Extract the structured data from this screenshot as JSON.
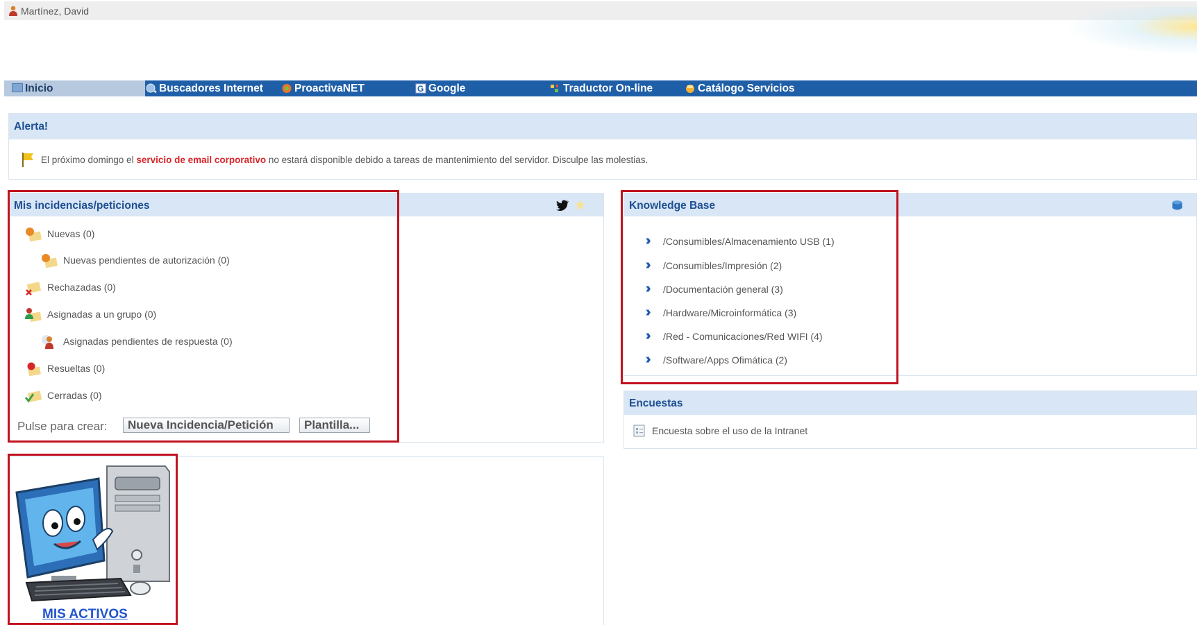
{
  "user": {
    "name": "Martínez, David",
    "icon": "user-icon"
  },
  "nav": {
    "items": [
      {
        "label": "Inicio",
        "icon": "home-icon",
        "active": true
      },
      {
        "label": "Buscadores Internet",
        "icon": "search-globe-icon"
      },
      {
        "label": "ProactivaNET",
        "icon": "proactivanet-icon"
      },
      {
        "label": "Google",
        "icon": "google-icon"
      },
      {
        "label": "Traductor On-line",
        "icon": "translator-icon"
      },
      {
        "label": "Catálogo Servicios",
        "icon": "catalog-icon"
      }
    ]
  },
  "alert": {
    "title": "Alerta!",
    "message_before": "El próximo domingo el ",
    "message_highlight": "servicio de email corporativo",
    "message_after": " no estará disponible debido a tareas de mantenimiento del servidor. Disculpe las molestias."
  },
  "incidents": {
    "title": "Mis incidencias/peticiones",
    "items": [
      {
        "label": "Nuevas (0)",
        "icon": "new-ticket-icon"
      },
      {
        "label": "Nuevas pendientes de autorización (0)",
        "icon": "pending-authorization-icon"
      },
      {
        "label": "Rechazadas (0)",
        "icon": "rejected-ticket-icon"
      },
      {
        "label": "Asignadas a un grupo (0)",
        "icon": "group-assigned-icon"
      },
      {
        "label": "Asignadas pendientes de respuesta (0)",
        "icon": "pending-response-icon"
      },
      {
        "label": "Resueltas (0)",
        "icon": "resolved-ticket-icon"
      },
      {
        "label": "Cerradas (0)",
        "icon": "closed-ticket-icon"
      }
    ],
    "create_label": "Pulse para crear:",
    "new_button": "Nueva Incidencia/Petición",
    "template_button": "Plantilla..."
  },
  "knowledge_base": {
    "title": "Knowledge Base",
    "items": [
      "/Consumibles/Almacenamiento USB (1)",
      "/Consumibles/Impresión (2)",
      "/Documentación general (3)",
      "/Hardware/Microinformática (3)",
      "/Red - Comunicaciones/Red WIFI (4)",
      "/Software/Apps Ofimática (2)"
    ]
  },
  "surveys": {
    "title": "Encuestas",
    "items": [
      "Encuesta sobre el uso de la Intranet"
    ]
  },
  "assets": {
    "link_label": "MIS ACTIVOS"
  },
  "colors": {
    "nav_bg": "#1f5fa8",
    "panel_header": "#d8e6f5",
    "title_blue": "#1d4f91",
    "highlight_red": "#d7262a",
    "box_red": "#c1121f",
    "link_blue": "#2255cc"
  }
}
